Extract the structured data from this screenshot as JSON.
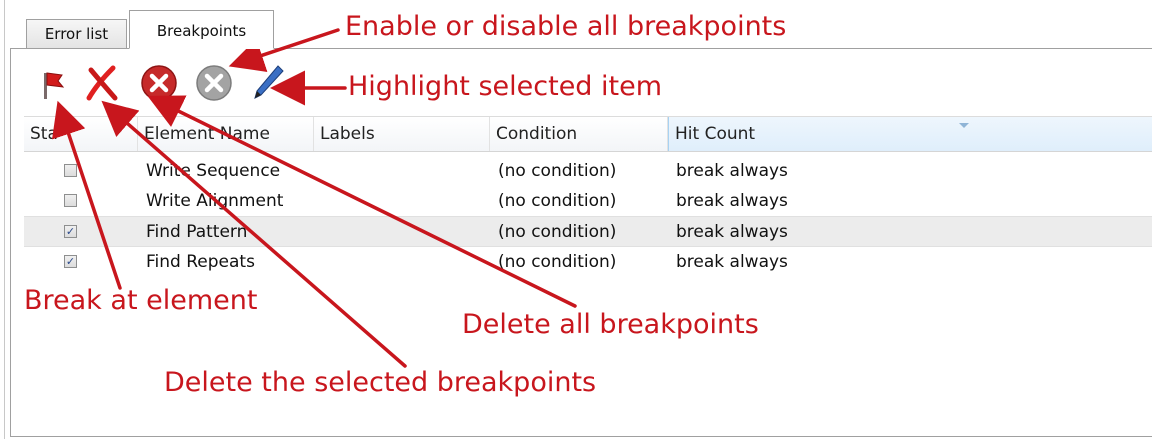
{
  "tabs": [
    {
      "label": "Error list",
      "active": false
    },
    {
      "label": "Breakpoints",
      "active": true
    }
  ],
  "toolbar": [
    {
      "name": "break-at-element",
      "icon": "red-flag-icon",
      "color": "#cc1b1b"
    },
    {
      "name": "delete-selected",
      "icon": "red-x-icon",
      "color": "#d82222"
    },
    {
      "name": "delete-all",
      "icon": "red-circle-x-icon",
      "color": "#c62a2a"
    },
    {
      "name": "enable-disable-all",
      "icon": "gray-circle-x-icon",
      "color": "#9a9a9a"
    },
    {
      "name": "highlight-selected",
      "icon": "pen-icon",
      "color": "#3a6fc4"
    }
  ],
  "table": {
    "columns": [
      "State",
      "Element Name",
      "Labels",
      "Condition",
      "Hit Count"
    ],
    "state_column_visible": "Sta",
    "rows": [
      {
        "checked": false,
        "element": "Write Sequence",
        "labels": "",
        "condition": "(no condition)",
        "hit_count": "break always"
      },
      {
        "checked": false,
        "element": "Write Alignment",
        "labels": "",
        "condition": "(no condition)",
        "hit_count": "break always"
      },
      {
        "checked": true,
        "element": "Find Pattern",
        "labels": "",
        "condition": "(no condition)",
        "hit_count": "break always"
      },
      {
        "checked": true,
        "element": "Find Repeats",
        "labels": "",
        "condition": "(no condition)",
        "hit_count": "break always"
      }
    ]
  },
  "callouts": {
    "enable_disable": "Enable or disable all breakpoints",
    "highlight": "Highlight selected item",
    "break_at": "Break at element",
    "delete_all": "Delete all breakpoints",
    "delete_selected": "Delete the selected breakpoints"
  },
  "colors": {
    "annotation": "#c8161d",
    "sorted_column": "#dfeefb"
  }
}
